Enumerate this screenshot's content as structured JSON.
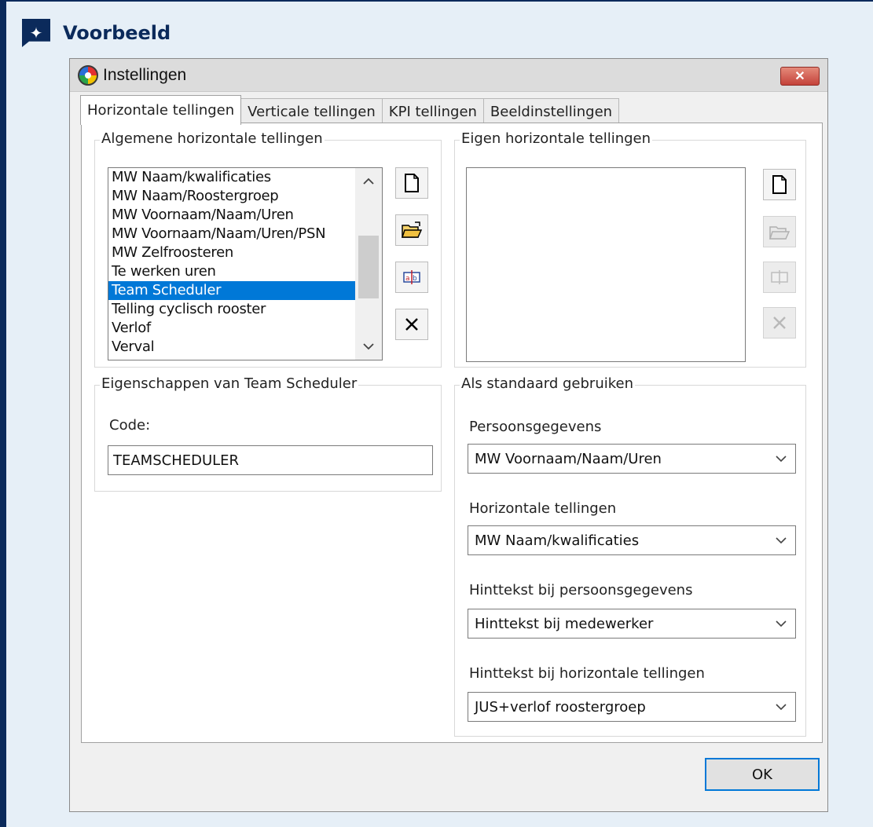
{
  "callout": {
    "title": "Voorbeeld",
    "icon": "sparkle-icon"
  },
  "window": {
    "title": "Instellingen",
    "close_label": "✕"
  },
  "tabs": [
    {
      "label": "Horizontale tellingen",
      "active": true
    },
    {
      "label": "Verticale tellingen",
      "active": false
    },
    {
      "label": "KPI tellingen",
      "active": false
    },
    {
      "label": "Beeldinstellingen",
      "active": false
    }
  ],
  "general_group": {
    "label": "Algemene horizontale tellingen",
    "items": [
      "MW Naam/kwalificaties",
      "MW Naam/Roostergroep",
      "MW Voornaam/Naam/Uren",
      "MW Voornaam/Naam/Uren/PSN",
      "MW Zelfroosteren",
      "Te werken uren",
      "Team Scheduler",
      "Telling cyclisch rooster",
      "Verlof",
      "Verval"
    ],
    "selected": "Team Scheduler"
  },
  "own_group": {
    "label": "Eigen horizontale tellingen",
    "items": []
  },
  "properties_group": {
    "label": "Eigenschappen van Team Scheduler",
    "code_label": "Code:",
    "code_value": "TEAMSCHEDULER"
  },
  "defaults_group": {
    "label": "Als standaard gebruiken",
    "fields": [
      {
        "label": "Persoonsgegevens",
        "value": "MW Voornaam/Naam/Uren"
      },
      {
        "label": "Horizontale tellingen",
        "value": "MW Naam/kwalificaties"
      },
      {
        "label": "Hinttekst bij persoonsgegevens",
        "value": "Hinttekst bij medewerker"
      },
      {
        "label": "Hinttekst bij horizontale tellingen",
        "value": "JUS+verlof roostergroep"
      }
    ]
  },
  "buttons": {
    "ok_label": "OK"
  }
}
